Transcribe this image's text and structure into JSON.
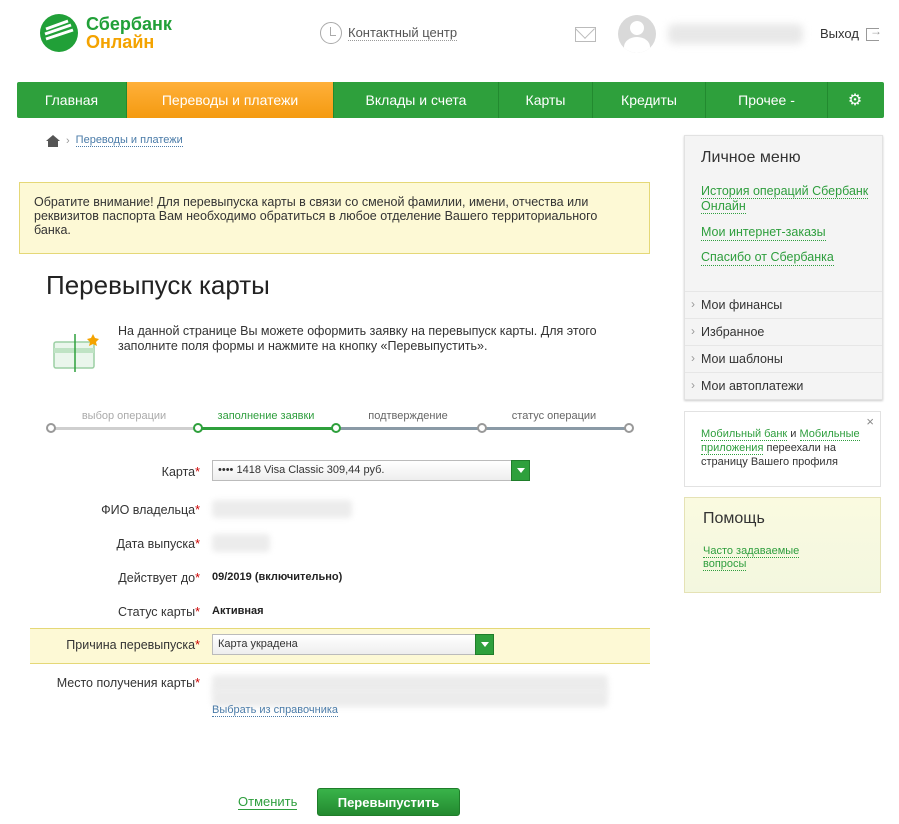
{
  "header": {
    "logo_line1": "Сбербанк",
    "logo_line2": "Онлайн",
    "contact_center": "Контактный центр",
    "logout": "Выход"
  },
  "nav": {
    "items": [
      {
        "label": "Главная"
      },
      {
        "label": "Переводы и платежи"
      },
      {
        "label": "Вклады и счета"
      },
      {
        "label": "Карты"
      },
      {
        "label": "Кредиты"
      },
      {
        "label": "Прочее -"
      }
    ],
    "active_index": 1
  },
  "breadcrumb": {
    "items": [
      "Переводы и платежи"
    ]
  },
  "notice": "Обратите внимание! Для перевыпуска карты в связи со сменой фамилии, имени, отчества или реквизитов паспорта Вам необходимо обратиться в любое отделение Вашего территориального банка.",
  "page": {
    "title": "Перевыпуск карты",
    "intro": "На данной странице Вы можете оформить заявку на перевыпуск карты. Для этого заполните поля формы и нажмите на кнопку «Перевыпустить»."
  },
  "steps": [
    {
      "label": "выбор операции",
      "state": "done"
    },
    {
      "label": "заполнение заявки",
      "state": "active"
    },
    {
      "label": "подтверждение",
      "state": "todo"
    },
    {
      "label": "статус операции",
      "state": "todo"
    }
  ],
  "form": {
    "card": {
      "label": "Карта",
      "value": "•••• 1418  Visa Classic  309,44  руб."
    },
    "owner": {
      "label": "ФИО владельца"
    },
    "issue_date": {
      "label": "Дата выпуска"
    },
    "valid_until": {
      "label": "Действует до",
      "value": "09/2019 (включительно)"
    },
    "status": {
      "label": "Статус карты",
      "value": "Активная"
    },
    "reason": {
      "label": "Причина перевыпуска",
      "value": "Карта украдена"
    },
    "pickup": {
      "label": "Место получения карты",
      "link": "Выбрать из справочника"
    },
    "required_mark": "*"
  },
  "actions": {
    "cancel": "Отменить",
    "submit": "Перевыпустить"
  },
  "sidebar": {
    "title": "Личное меню",
    "links": [
      "История операций Сбербанк Онлайн",
      "Мои интернет-заказы",
      "Спасибо от Сбербанка"
    ],
    "items": [
      "Мои финансы",
      "Избранное",
      "Мои шаблоны",
      "Мои автоплатежи"
    ]
  },
  "mobile_notice": {
    "link1": "Мобильный банк",
    "and": "и",
    "link2": "Мобильные приложения",
    "text": "переехали на страницу Вашего профиля",
    "close": "×"
  },
  "help": {
    "title": "Помощь",
    "link": "Часто задаваемые вопросы"
  },
  "colors": {
    "brand_green": "#2ea03c",
    "accent_orange": "#f4a300",
    "notice_bg": "#fdf9d5"
  }
}
